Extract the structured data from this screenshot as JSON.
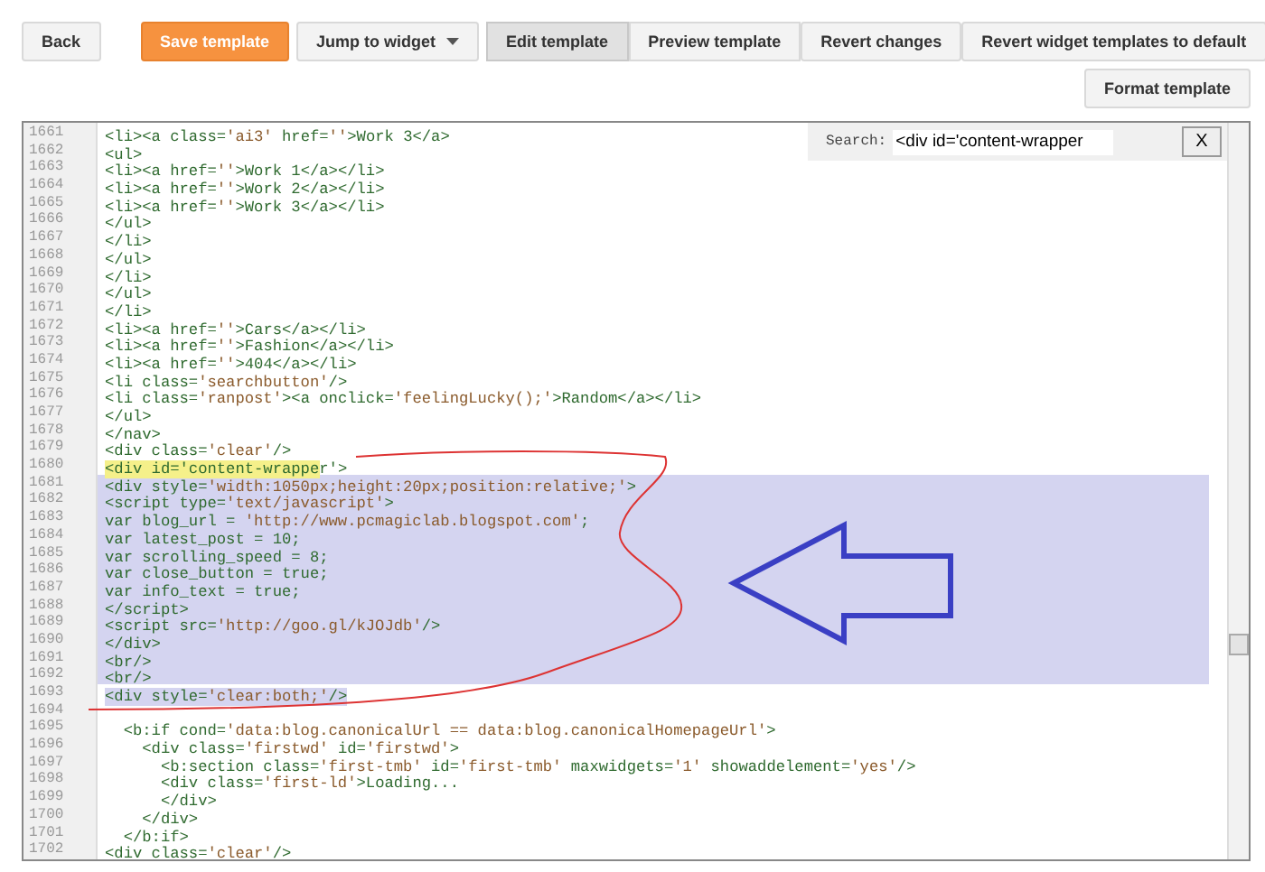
{
  "toolbar": {
    "buttons": [
      {
        "label": "Back",
        "kind": "plain"
      },
      {
        "label": "Save template",
        "kind": "primary"
      },
      {
        "label": "Jump to widget",
        "kind": "dropdown"
      },
      {
        "label": "Edit template",
        "kind": "tab",
        "selected": true
      },
      {
        "label": "Preview template",
        "kind": "tab",
        "selected": false
      },
      {
        "label": "Revert changes",
        "kind": "right"
      },
      {
        "label": "Revert widget templates to default",
        "kind": "right"
      }
    ],
    "format_button": "Format template"
  },
  "search": {
    "label": "Search:",
    "value": "<div id='content-wrapper",
    "close": "X"
  },
  "lines": [
    {
      "number": "1661",
      "code": "<li><a class='ai3' href=''>Work 3</a>",
      "selected": false
    },
    {
      "number": "1662",
      "code": "<ul>",
      "selected": false
    },
    {
      "number": "1663",
      "code": "<li><a href=''>Work 1</a></li>",
      "selected": false
    },
    {
      "number": "1664",
      "code": "<li><a href=''>Work 2</a></li>",
      "selected": false
    },
    {
      "number": "1665",
      "code": "<li><a href=''>Work 3</a></li>",
      "selected": false
    },
    {
      "number": "1666",
      "code": "</ul>",
      "selected": false
    },
    {
      "number": "1667",
      "code": "</li>",
      "selected": false
    },
    {
      "number": "1668",
      "code": "</ul>",
      "selected": false
    },
    {
      "number": "1669",
      "code": "</li>",
      "selected": false
    },
    {
      "number": "1670",
      "code": "</ul>",
      "selected": false
    },
    {
      "number": "1671",
      "code": "</li>",
      "selected": false
    },
    {
      "number": "1672",
      "code": "<li><a href=''>Cars</a></li>",
      "selected": false
    },
    {
      "number": "1673",
      "code": "<li><a href=''>Fashion</a></li>",
      "selected": false
    },
    {
      "number": "1674",
      "code": "<li><a href=''>404</a></li>",
      "selected": false
    },
    {
      "number": "1675",
      "code": "<li class='searchbutton'/>",
      "selected": false
    },
    {
      "number": "1676",
      "code": "<li class='ranpost'><a onclick='feelingLucky();'>Random</a></li>",
      "selected": false
    },
    {
      "number": "1677",
      "code": "</ul>",
      "selected": false
    },
    {
      "number": "1678",
      "code": "</nav>",
      "selected": false
    },
    {
      "number": "1679",
      "code": "<div class='clear'/>",
      "selected": false
    },
    {
      "number": "1680",
      "match": "<div id='content-wrappe",
      "code": "r'>",
      "selected": false
    },
    {
      "number": "1681",
      "code": "<div style='width:1050px;height:20px;position:relative;'>",
      "selected": true
    },
    {
      "number": "1682",
      "code": "<script type='text/javascript'>",
      "selected": true
    },
    {
      "number": "1683",
      "code": "var blog_url = 'http://www.pcmagiclab.blogspot.com';",
      "selected": true
    },
    {
      "number": "1684",
      "code": "var latest_post = 10;",
      "selected": true
    },
    {
      "number": "1685",
      "code": "var scrolling_speed = 8;",
      "selected": true
    },
    {
      "number": "1686",
      "code": "var close_button = true;",
      "selected": true
    },
    {
      "number": "1687",
      "code": "var info_text = true;",
      "selected": true
    },
    {
      "number": "1688",
      "code": "</script>",
      "selected": true
    },
    {
      "number": "1689",
      "code": "<script src='http://goo.gl/kJOJdb'/>",
      "selected": true
    },
    {
      "number": "1690",
      "code": "</div>",
      "selected": true
    },
    {
      "number": "1691",
      "code": "<br/>",
      "selected": true
    },
    {
      "number": "1692",
      "code": "<br/>",
      "selected": true
    },
    {
      "number": "1693",
      "code": "<div style='clear:both;'/>",
      "selected": true
    },
    {
      "number": "1694"
    },
    {
      "number": "1695",
      "code": "  <b:if cond='data:blog.canonicalUrl == data:blog.canonicalHomepageUrl'>",
      "selected": false
    },
    {
      "number": "1696",
      "code": "    <div class='firstwd' id='firstwd'>",
      "selected": false
    },
    {
      "number": "1697",
      "code": "      <b:section class='first-tmb' id='first-tmb' maxwidgets='1' showaddelement='yes'/>",
      "selected": false
    },
    {
      "number": "1698",
      "code": "      <div class='first-ld'>Loading...",
      "selected": false
    },
    {
      "number": "1699",
      "code": "      </div>",
      "selected": false
    },
    {
      "number": "1700",
      "code": "    </div>",
      "selected": false
    },
    {
      "number": "1701",
      "code": "  </b:if>",
      "selected": false
    },
    {
      "number": "1702",
      "code": "<div class='clear'/>",
      "selected": false
    }
  ]
}
